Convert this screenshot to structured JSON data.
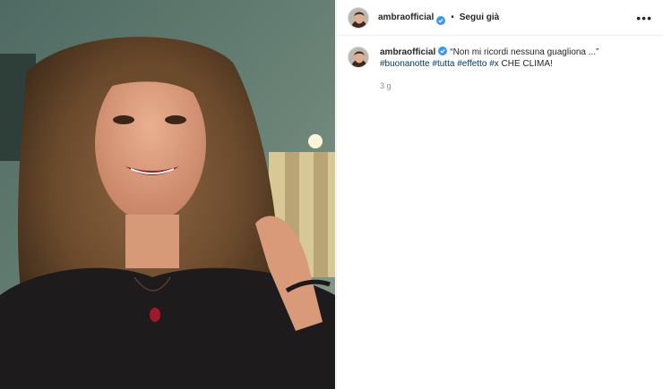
{
  "post": {
    "username": "ambraofficial",
    "separator": "•",
    "follow_label": "Segui già",
    "more_label": "•••",
    "caption_text": "“Non mi ricordi nessuna guagliona ...”",
    "hashtags": [
      "#buonanotte",
      "#tutta",
      "#effetto",
      "#x"
    ],
    "caption_tail": "CHE CLIMA!",
    "timestamp": "3 g"
  },
  "colors": {
    "verified_badge": "#3897f0",
    "hashtag": "#00376b",
    "meta_gray": "#8e8e8e"
  },
  "icons": {
    "verified": "verified-badge-icon",
    "more": "more-options-icon"
  }
}
